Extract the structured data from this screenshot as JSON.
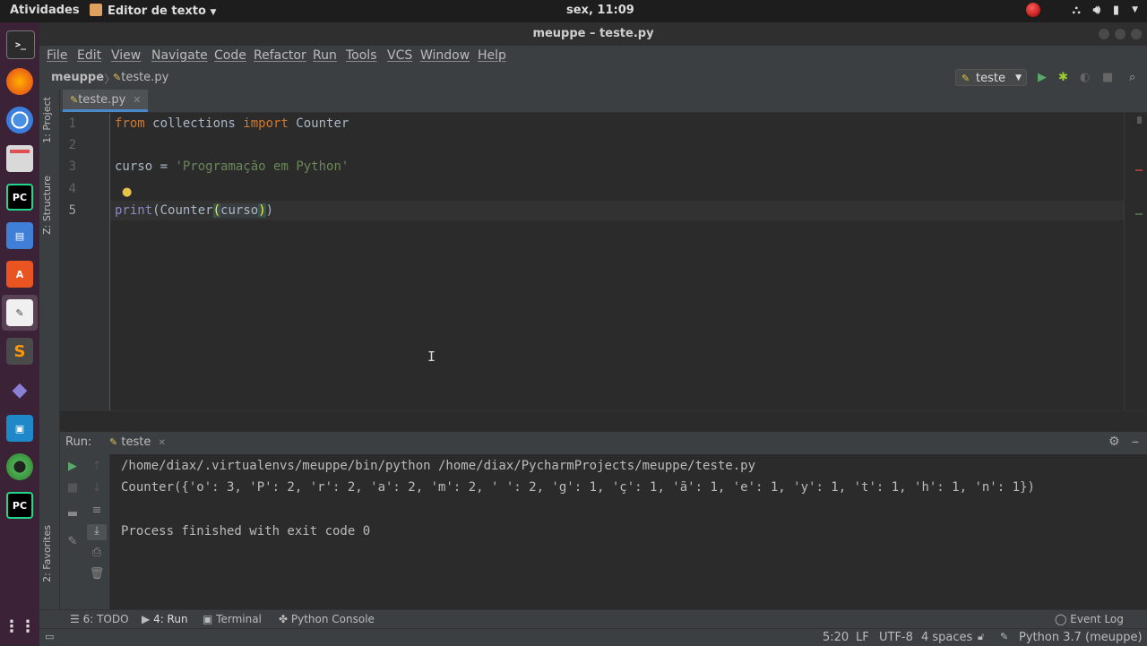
{
  "topbar": {
    "activities": "Atividades",
    "app_name": "Editor de texto",
    "clock": "sex, 11:09"
  },
  "window": {
    "title": "meuppe – teste.py"
  },
  "menu": [
    "File",
    "Edit",
    "View",
    "Navigate",
    "Code",
    "Refactor",
    "Run",
    "Tools",
    "VCS",
    "Window",
    "Help"
  ],
  "navbar": {
    "project": "meuppe",
    "file": "teste.py",
    "run_config": "teste"
  },
  "left_strip": {
    "project": "1: Project",
    "structure": "Z: Structure",
    "favorites": "2: Favorites"
  },
  "editor": {
    "tab_label": "teste.py",
    "line_numbers": [
      "1",
      "2",
      "3",
      "4",
      "5"
    ],
    "code": {
      "l1_kw1": "from",
      "l1_mod": " collections ",
      "l1_kw2": "import",
      "l1_name": " Counter",
      "l3_var": "curso",
      "l3_eq": " = ",
      "l3_str": "'Programação em Python'",
      "l5_print": "print",
      "l5_open": "(Counter",
      "l5_p1": "(",
      "l5_arg": "curso",
      "l5_p2": ")",
      "l5_close": ")"
    }
  },
  "run_panel": {
    "label": "Run:",
    "tab": "teste",
    "lines": [
      "/home/diax/.virtualenvs/meuppe/bin/python /home/diax/PycharmProjects/meuppe/teste.py",
      "Counter({'o': 3, 'P': 2, 'r': 2, 'a': 2, 'm': 2, ' ': 2, 'g': 1, 'ç': 1, 'ã': 1, 'e': 1, 'y': 1, 't': 1, 'h': 1, 'n': 1})",
      "",
      "Process finished with exit code 0"
    ]
  },
  "bottom_tabs": {
    "todo": "6: TODO",
    "run": "4: Run",
    "terminal": "Terminal",
    "python_console": "Python Console",
    "event_log": "Event Log"
  },
  "status": {
    "position": "5:20",
    "line_sep": "LF",
    "encoding": "UTF-8",
    "indent": "4 spaces",
    "interpreter": "Python 3.7 (meuppe)"
  },
  "colors": {
    "keyword": "#cc7832",
    "string": "#6a8759",
    "builtin": "#8888c6",
    "text": "#a9b7c6",
    "background": "#2b2b2b"
  }
}
